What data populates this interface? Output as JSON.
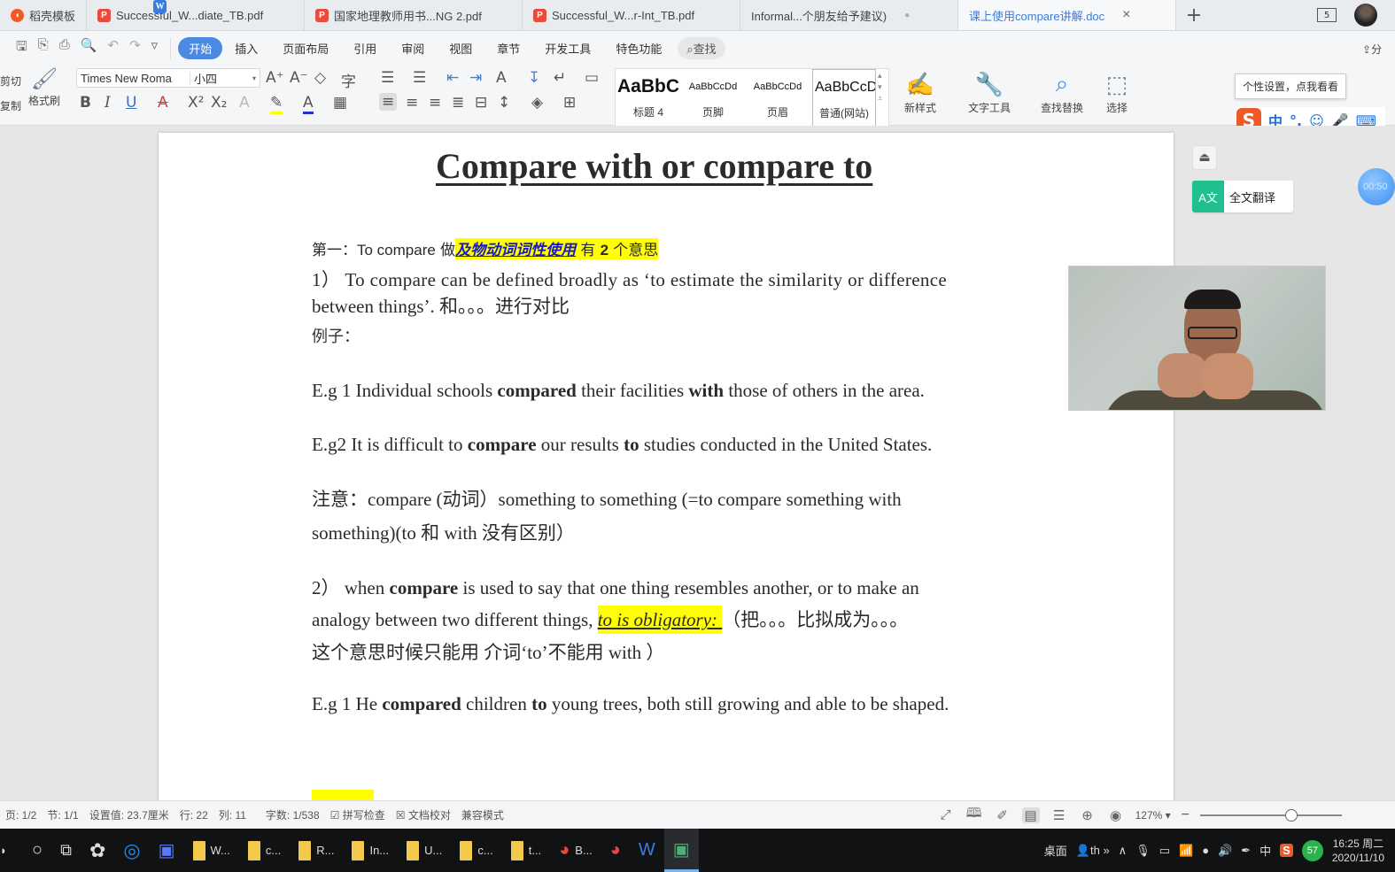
{
  "tabs": [
    {
      "label": "稻壳模板",
      "icon": "daoke-icon",
      "type": "dk"
    },
    {
      "label": "Successful_W...diate_TB.pdf",
      "icon": "pdf-icon",
      "type": "pdf"
    },
    {
      "label": "国家地理教师用书...NG 2.pdf",
      "icon": "pdf-icon",
      "type": "pdf"
    },
    {
      "label": "Successful_W...r-Int_TB.pdf",
      "icon": "pdf-icon",
      "type": "pdf"
    },
    {
      "label": "Informal...个朋友给予建议)",
      "icon": "word-icon",
      "type": "doc"
    },
    {
      "label": "课上使用compare讲解.doc",
      "icon": "word-icon",
      "type": "doc",
      "active": true
    }
  ],
  "tabbar": {
    "add": "+",
    "badge": "5",
    "close": "×",
    "dot": "●"
  },
  "menu": {
    "items": [
      "开始",
      "插入",
      "页面布局",
      "引用",
      "审阅",
      "视图",
      "章节",
      "开发工具",
      "特色功能"
    ],
    "search": "查找",
    "share": "分"
  },
  "toolbar": {
    "cut": "剪切",
    "copy": "复制",
    "format_painter": "格式刷",
    "font_name": "Times New Roma",
    "font_size": "小四",
    "styles": [
      {
        "sample": "AaBbC",
        "name": "标题 4"
      },
      {
        "sample": "AaBbCcDd",
        "name": "页脚"
      },
      {
        "sample": "AaBbCcDd",
        "name": "页眉"
      },
      {
        "sample": "AaBbCcDd",
        "name": "普通(网站)"
      }
    ],
    "new_style": "新样式",
    "text_tools": "文字工具",
    "find_replace": "查找替换",
    "select": "选择"
  },
  "ime": {
    "tooltip": "个性设置，点我看看",
    "logo": "S",
    "mode": "中",
    "punct": "°,",
    "emoji": "☺",
    "mic": "🎤",
    "kbd": "⌨"
  },
  "document": {
    "title": "Compare with or compare to",
    "heading": {
      "prefix": "第一：",
      "term": "To compare",
      "do": "做",
      "highlight": "及物动词词性使用",
      "suffix_a": "有",
      "suffix_num": "2",
      "suffix_b": "个意思"
    },
    "p1_line1": "1）  To compare can be defined broadly as ‘to estimate the similarity or difference",
    "p1_line2": "between things’.   和。。。进行对比",
    "examples_label": "例子：",
    "eg1": {
      "a": "E.g 1 Individual schools ",
      "b": "compared",
      "c": " their facilities ",
      "d": "with",
      "e": " those of others in the area."
    },
    "eg2": {
      "a": "E.g2 It is difficult to ",
      "b": "compare",
      "c": " our results ",
      "d": "to",
      "e": " studies conducted in the United States."
    },
    "note_line1": "注意：compare (动词）something to something (=to compare something with",
    "note_line2": "something)(to  和  with  没有区别）",
    "p2_line1": {
      "a": "2）  when ",
      "b": "compare",
      "c": " is used to say that one thing resembles another, or to make an"
    },
    "p2_line2": {
      "a": "analogy between two different things, ",
      "hl": "to is obligatory: ",
      "b": "（把。。。比拟成为。。。"
    },
    "p2_line3": "这个意思时候只能用  介词‘to’不能用 with  ）",
    "eg3": {
      "a": "E.g 1 He ",
      "b": "compared",
      "c": " children ",
      "d": "to",
      "e": " young trees, both still growing and able to be shaped."
    }
  },
  "side": {
    "translate": "全文翻译",
    "timer": "00:50"
  },
  "status": {
    "page": "页: 1/2",
    "section": "节: 1/1",
    "setting": "设置值: 23.7厘米",
    "row": "行: 22",
    "col": "列: 11",
    "words": "字数: 1/538",
    "spell": "拼写检查",
    "proof": "文档校对",
    "compat": "兼容模式",
    "zoom": "127%",
    "zoom_level": 0.6
  },
  "taskbar": {
    "folders": [
      "W...",
      "c...",
      "R...",
      "In...",
      "U...",
      "c...",
      "t..."
    ],
    "chrome": "B...",
    "desktop": "桌面",
    "th": "th",
    "lang": "中",
    "battery": "57",
    "time": "16:25 周二",
    "date": "2020/11/10"
  }
}
